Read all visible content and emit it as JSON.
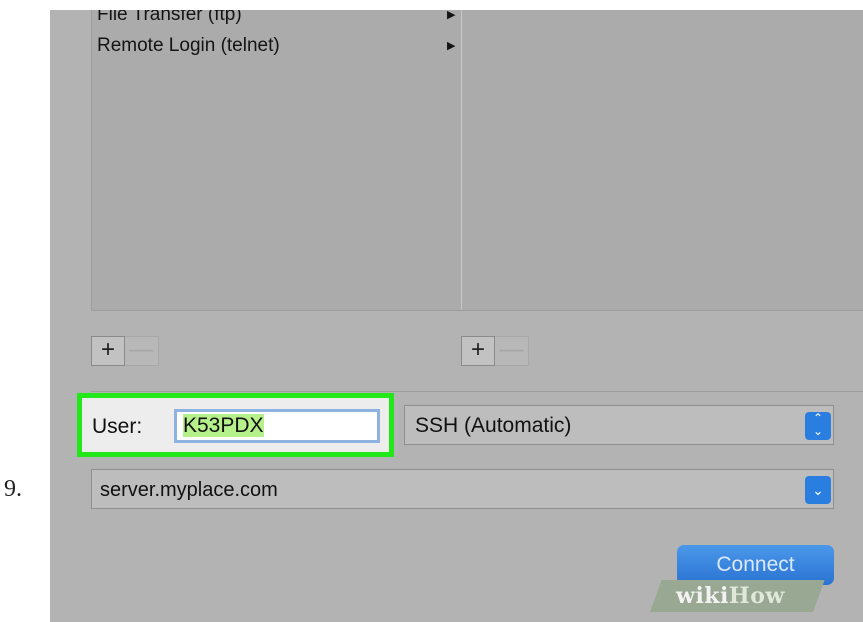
{
  "step_number": "9.",
  "services": [
    {
      "label": "File Transfer (ftp)"
    },
    {
      "label": "Remote Login (telnet)"
    }
  ],
  "add_symbol": "+",
  "remove_symbol": "—",
  "user": {
    "label": "User:",
    "value": "K53PDX"
  },
  "protocol": {
    "selected": "SSH (Automatic)"
  },
  "server": {
    "value": "server.myplace.com"
  },
  "connect_label": "Connect",
  "watermark": {
    "prefix": "wiki",
    "suffix": "How"
  },
  "colors": {
    "highlight": "#22e81a",
    "accent": "#2a7ee0",
    "window_bg": "#b3b3b3"
  }
}
